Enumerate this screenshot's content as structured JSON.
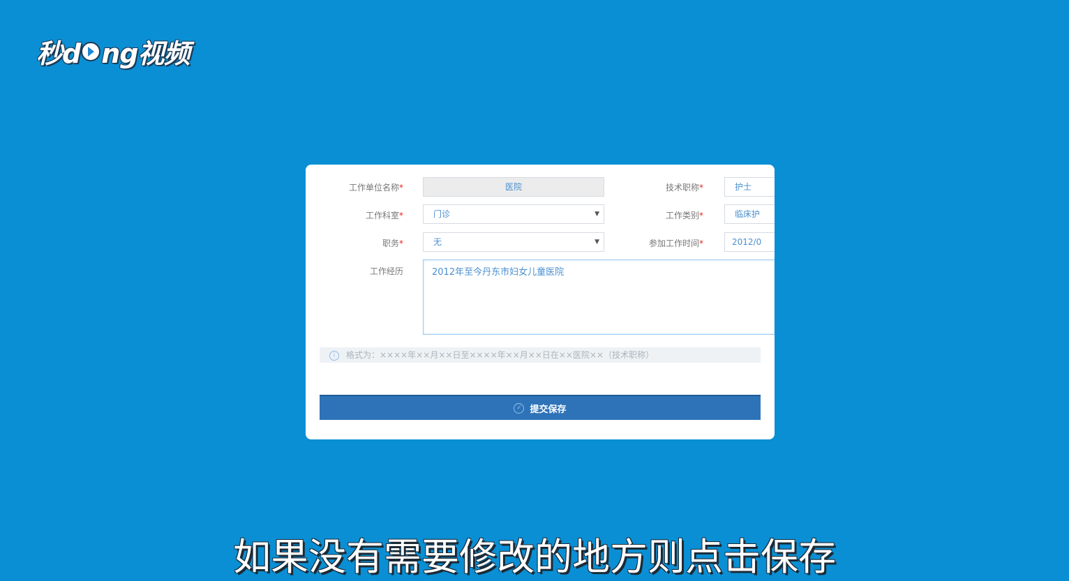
{
  "brand": {
    "logo_text_1": "秒d",
    "logo_text_2": "ng视频",
    "colors": {
      "background": "#0a8fd4",
      "primary_button": "#2e73b8"
    }
  },
  "form": {
    "work_unit": {
      "label": "工作单位名称",
      "value": "医院"
    },
    "department": {
      "label": "工作科室",
      "value": "门诊"
    },
    "position": {
      "label": "职务",
      "value": "无"
    },
    "tech_title": {
      "label": "技术职称",
      "value": "护士"
    },
    "work_category": {
      "label": "工作类别",
      "value": "临床护"
    },
    "start_date": {
      "label": "参加工作时间",
      "value": "2012/0"
    },
    "experience": {
      "label": "工作经历",
      "value": "2012年至今丹东市妇女儿童医院"
    },
    "required_mark": "*",
    "hint": "格式为：××××年××月××日至××××年××月××日在××医院××（技术职称）",
    "submit_label": "提交保存"
  },
  "subtitle": "如果没有需要修改的地方则点击保存"
}
